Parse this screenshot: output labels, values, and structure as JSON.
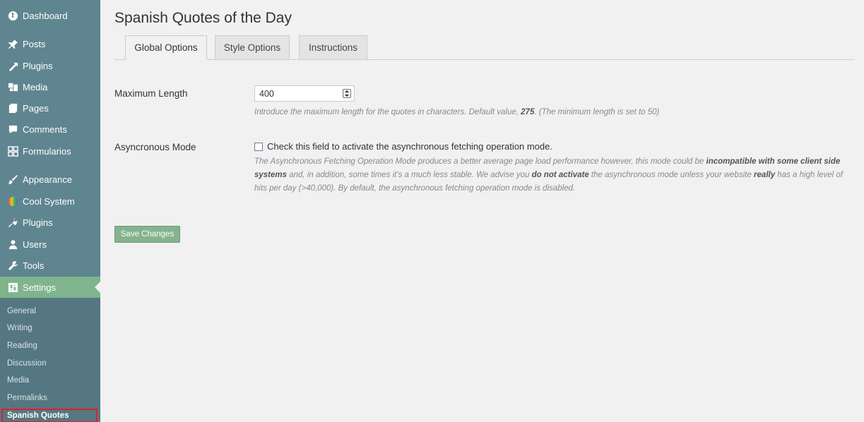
{
  "sidebar": {
    "items": [
      {
        "label": "Dashboard",
        "icon": "dashboard-icon"
      },
      {
        "label": "Posts",
        "icon": "pin-icon"
      },
      {
        "label": "Plugins",
        "icon": "plugin-arrow-icon"
      },
      {
        "label": "Media",
        "icon": "media-icon"
      },
      {
        "label": "Pages",
        "icon": "pages-icon"
      },
      {
        "label": "Comments",
        "icon": "comments-icon"
      },
      {
        "label": "Formularios",
        "icon": "grid-icon"
      },
      {
        "label": "Appearance",
        "icon": "paintbrush-icon"
      },
      {
        "label": "Cool System",
        "icon": "rainbow-circle-icon"
      },
      {
        "label": "Plugins",
        "icon": "plug-icon"
      },
      {
        "label": "Users",
        "icon": "user-icon"
      },
      {
        "label": "Tools",
        "icon": "wrench-icon"
      },
      {
        "label": "Settings",
        "icon": "settings-icon"
      }
    ],
    "submenu": [
      "General",
      "Writing",
      "Reading",
      "Discussion",
      "Media",
      "Permalinks",
      "Spanish Quotes"
    ],
    "active_color": "#7fb48c",
    "background_color": "#5f8590"
  },
  "page": {
    "title": "Spanish Quotes of the Day",
    "tabs": [
      "Global Options",
      "Style Options",
      "Instructions"
    ]
  },
  "fields": {
    "max_length": {
      "label": "Maximum Length",
      "value": "400",
      "desc_prefix": "Introduce the maximum length for the quotes in characters. Default value, ",
      "desc_default": "275",
      "desc_suffix": ". (The minimum length is set to 50)"
    },
    "async": {
      "label": "Asyncronous Mode",
      "checkbox_label": "Check this field to activate the asynchronous fetching operation mode.",
      "checked": false,
      "desc1": "The Asynchronous Fetching Operation Mode produces a better average page load performance however, this mode could be ",
      "desc_b1": "incompatible with some client side systems",
      "desc2": " and, in addition, some times it's a much less stable. We advise you ",
      "desc_b2": "do not activate",
      "desc3": " the asynchronous mode unless your website ",
      "desc_b3": "really",
      "desc4": " has a high level of hits per day (>40,000). By default, the asynchronous fetching operation mode is disabled."
    }
  },
  "buttons": {
    "save": "Save Changes"
  }
}
